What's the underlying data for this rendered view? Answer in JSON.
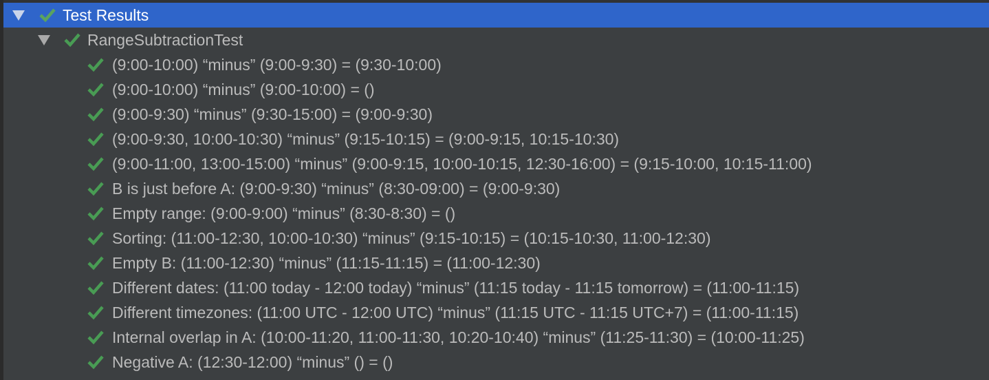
{
  "root": {
    "label": "Test Results",
    "status": "passed"
  },
  "suite": {
    "label": "RangeSubtractionTest",
    "status": "passed"
  },
  "tests": [
    "(9:00-10:00) “minus” (9:00-9:30) = (9:30-10:00)",
    "(9:00-10:00) “minus” (9:00-10:00) = ()",
    "(9:00-9:30) “minus” (9:30-15:00) = (9:00-9:30)",
    "(9:00-9:30, 10:00-10:30) “minus” (9:15-10:15) = (9:00-9:15, 10:15-10:30)",
    "(9:00-11:00, 13:00-15:00) “minus” (9:00-9:15, 10:00-10:15, 12:30-16:00) = (9:15-10:00, 10:15-11:00)",
    "B is just before A: (9:00-9:30) “minus” (8:30-09:00) = (9:00-9:30)",
    "Empty range: (9:00-9:00) “minus” (8:30-8:30) = ()",
    "Sorting: (11:00-12:30, 10:00-10:30) “minus” (9:15-10:15) = (10:15-10:30, 11:00-12:30)",
    "Empty B: (11:00-12:30) “minus” (11:15-11:15) = (11:00-12:30)",
    "Different dates: (11:00 today - 12:00 today) “minus” (11:15 today - 11:15 tomorrow) = (11:00-11:15)",
    "Different timezones: (11:00 UTC - 12:00 UTC) “minus” (11:15 UTC - 11:15 UTC+7) = (11:00-11:15)",
    "Internal overlap in A: (10:00-11:20, 11:00-11:30, 10:20-10:40) “minus” (11:25-11:30) = (10:00-11:25)",
    "Negative A: (12:30-12:00) “minus” () = ()"
  ],
  "colors": {
    "selection": "#2f65ca",
    "passed": "#499c54",
    "background": "#3c3f41",
    "text": "#bbbbbb"
  }
}
